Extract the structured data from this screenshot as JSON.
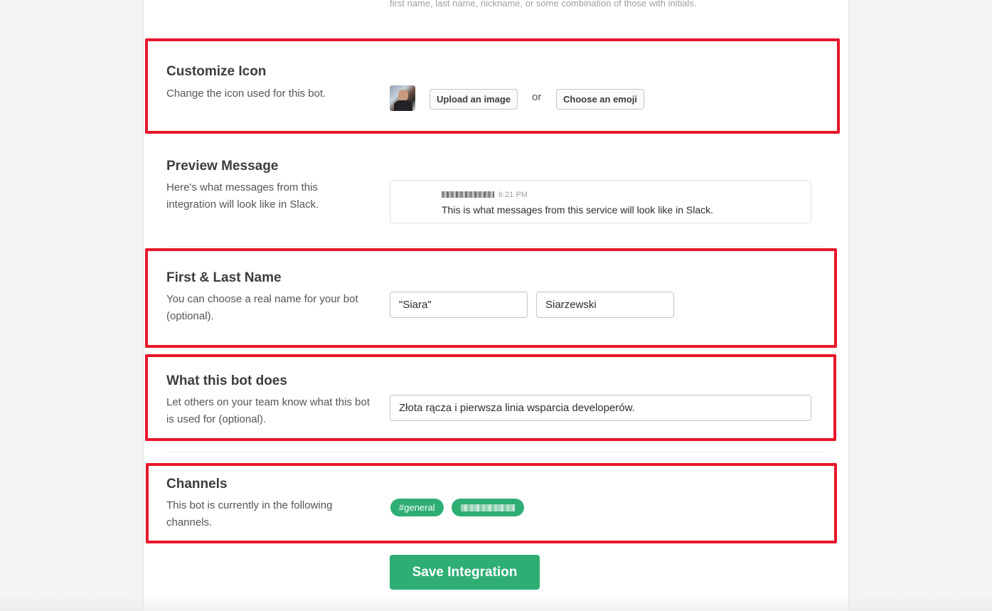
{
  "top_hint": "first name, last name, nickname, or some combination of those with initials.",
  "customize_icon": {
    "title": "Customize Icon",
    "description": "Change the icon used for this bot.",
    "upload_label": "Upload an image",
    "or_label": "or",
    "emoji_label": "Choose an emoji"
  },
  "preview": {
    "title": "Preview Message",
    "description": "Here's what messages from this integration will look like in Slack.",
    "time": "6:21 PM",
    "message": "This is what messages from this service will look like in Slack."
  },
  "name": {
    "title": "First & Last Name",
    "description": "You can choose a real name for your bot (optional).",
    "first_value": "\"Siara\"",
    "last_value": "Siarzewski"
  },
  "what_does": {
    "title": "What this bot does",
    "description": "Let others on your team know what this bot is used for (optional).",
    "value": "Złota rącza i pierwsza linia wsparcia developerów."
  },
  "channels": {
    "title": "Channels",
    "description": "This bot is currently in the following channels.",
    "items": [
      "#general"
    ]
  },
  "save_label": "Save Integration",
  "colors": {
    "accent_green": "#2fae74",
    "highlight_red": "#e8162b"
  }
}
